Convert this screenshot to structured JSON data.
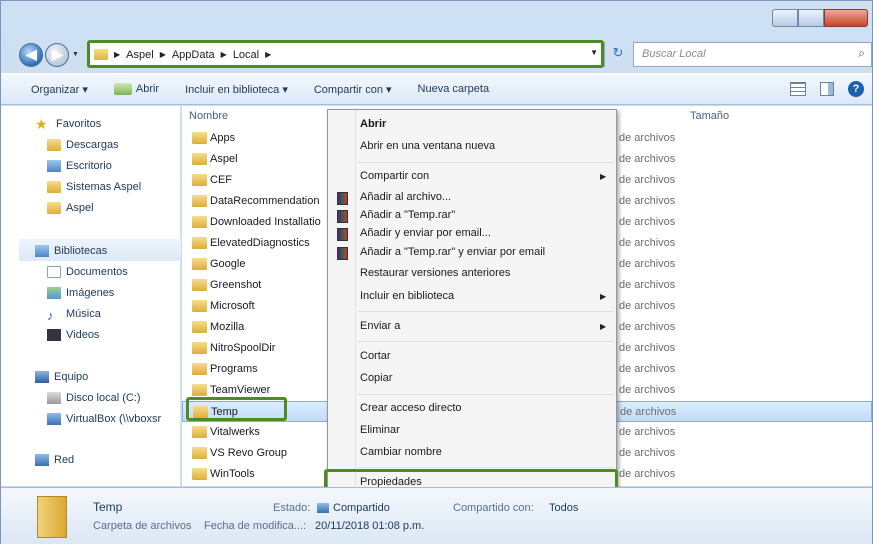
{
  "address": {
    "crumbs": [
      "Aspel",
      "AppData",
      "Local"
    ],
    "search_placeholder": "Buscar Local"
  },
  "toolbar": {
    "organize": "Organizar ▾",
    "open": "Abrir",
    "include_library": "Incluir en biblioteca ▾",
    "share": "Compartir con ▾",
    "new_folder": "Nueva carpeta"
  },
  "nav": {
    "favorites": "Favoritos",
    "downloads": "Descargas",
    "desktop": "Escritorio",
    "aspel_systems": "Sistemas Aspel",
    "aspel": "Aspel",
    "libraries": "Bibliotecas",
    "documents": "Documentos",
    "images": "Imágenes",
    "music": "Música",
    "videos": "Videos",
    "computer": "Equipo",
    "local_disk": "Disco local (C:)",
    "virtualbox": "VirtualBox (\\\\vboxsr",
    "network": "Red"
  },
  "columns": {
    "name": "Nombre",
    "size": "Tamaño"
  },
  "files": [
    "Apps",
    "Aspel",
    "CEF",
    "DataRecommendation",
    "Downloaded Installatio",
    "ElevatedDiagnostics",
    "Google",
    "Greenshot",
    "Microsoft",
    "Mozilla",
    "NitroSpoolDir",
    "Programs",
    "TeamViewer",
    "Temp",
    "Vitalwerks",
    "VS Revo Group",
    "WinTools"
  ],
  "file_type": "de archivos",
  "context_menu": {
    "open": "Abrir",
    "open_new_window": "Abrir en una ventana nueva",
    "share_with": "Compartir con",
    "add_to_archive": "Añadir al archivo...",
    "add_to_temp_rar": "Añadir a \"Temp.rar\"",
    "compress_email": "Añadir y enviar por email...",
    "add_temp_rar_email": "Añadir a \"Temp.rar\" y enviar por email",
    "restore_versions": "Restaurar versiones anteriores",
    "include_library": "Incluir en biblioteca",
    "send_to": "Enviar a",
    "cut": "Cortar",
    "copy": "Copiar",
    "create_shortcut": "Crear acceso directo",
    "delete": "Eliminar",
    "rename": "Cambiar nombre",
    "properties": "Propiedades"
  },
  "status": {
    "name": "Temp",
    "type": "Carpeta de archivos",
    "state_label": "Estado:",
    "state_value": "Compartido",
    "shared_label": "Compartido con:",
    "shared_value": "Todos",
    "modified_label": "Fecha de modifica...:",
    "modified_value": "20/11/2018 01:08 p.m."
  }
}
